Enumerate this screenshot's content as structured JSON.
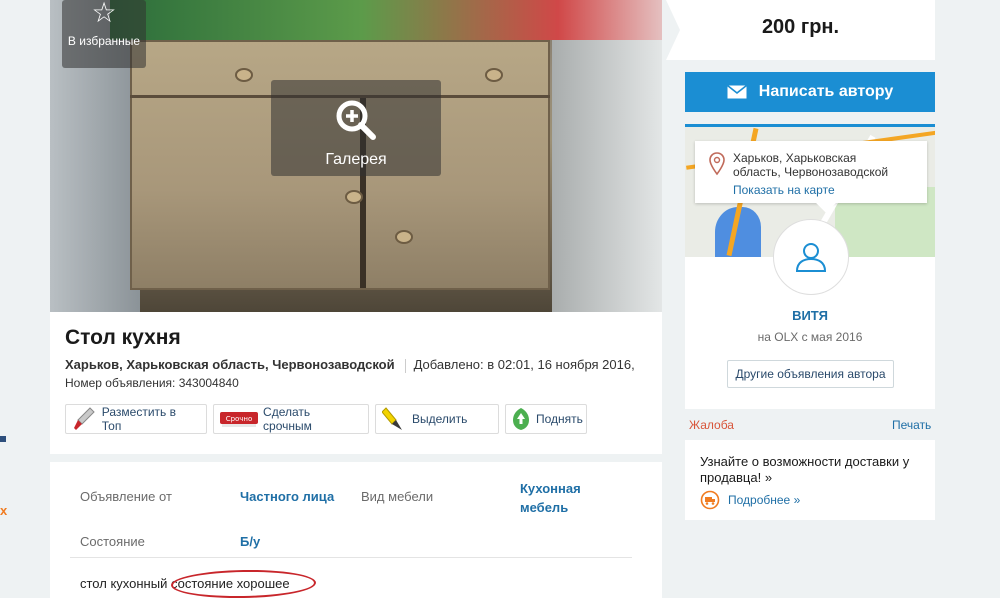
{
  "listing": {
    "favorite_label": "В избранные",
    "gallery_label": "Галерея",
    "title": "Стол кухня",
    "location": "Харьков, Харьковская область, Червонозаводской",
    "added": "Добавлено: в 02:01, 16 ноября 2016,",
    "ad_number": "Номер объявления: 343004840",
    "actions": {
      "top": "Разместить в Топ",
      "urgent": "Сделать срочным",
      "highlight": "Выделить",
      "raise": "Поднять",
      "urgent_badge": "Срочно"
    },
    "params": {
      "from_label": "Объявление от",
      "from_value": "Частного лица",
      "type_label": "Вид мебели",
      "type_value_line1": "Кухонная",
      "type_value_line2": "мебель",
      "condition_label": "Состояние",
      "condition_value": "Б/у"
    },
    "description": {
      "part1": "стол кухонный",
      "part2": "состояние хорошее"
    }
  },
  "sidebar": {
    "price": "200 грн.",
    "write_button": "Написать автору",
    "map": {
      "address_line1": "Харьков, Харьковская",
      "address_line2": "область, Червонозаводской",
      "show_on_map": "Показать на карте"
    },
    "author": {
      "name": "ВИТЯ",
      "since": "на OLX с мая 2016",
      "other_ads": "Другие объявления автора"
    },
    "complaint": "Жалоба",
    "print": "Печать",
    "delivery": {
      "text": "Узнайте о возможности доставки у продавца! »",
      "more": "Подробнее »"
    }
  },
  "colors": {
    "accent_blue": "#1b8ed3",
    "link_blue": "#1f6fa6",
    "complaint_orange": "#d8553a",
    "annotation_red": "#c8262b"
  },
  "icons": [
    "star-icon",
    "zoom-in-icon",
    "rocket-icon",
    "urgent-badge-icon",
    "marker-icon",
    "raise-icon",
    "envelope-icon",
    "map-pin-icon",
    "user-icon",
    "delivery-icon"
  ]
}
